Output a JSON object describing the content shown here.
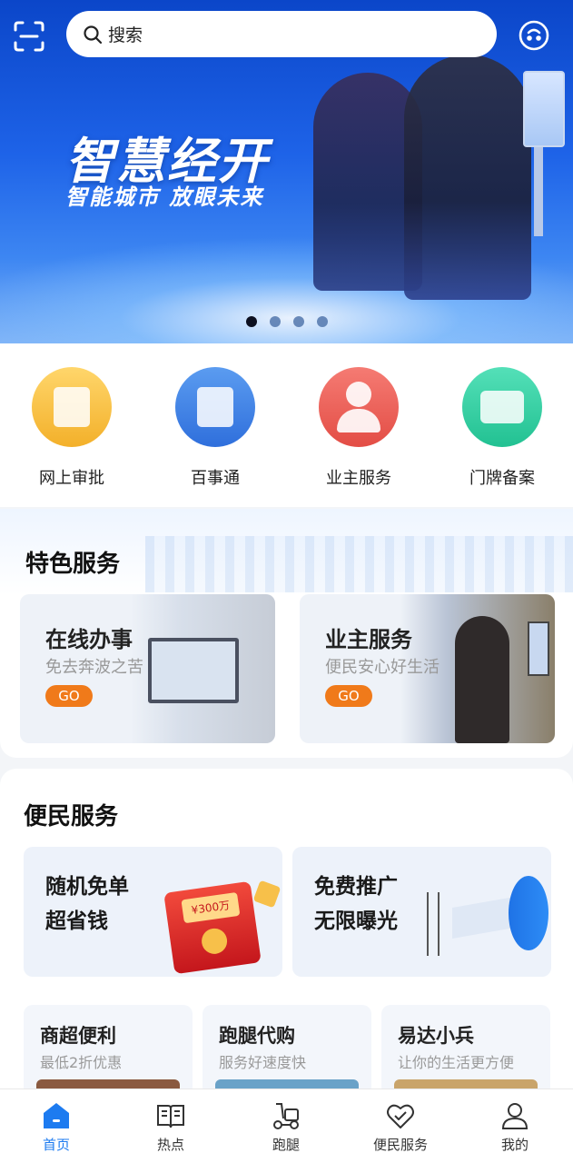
{
  "search": {
    "placeholder": "搜索"
  },
  "banner": {
    "title": "智慧经开",
    "subtitle": "智能城市 放眼未来",
    "slides": 4,
    "active_slide": 1
  },
  "quick_actions": [
    {
      "label": "网上审批",
      "icon": "approval-document-icon",
      "color": "#f3b02a"
    },
    {
      "label": "百事通",
      "icon": "info-card-icon",
      "color": "#2f6fdc"
    },
    {
      "label": "业主服务",
      "icon": "owner-person-icon",
      "color": "#e34d45"
    },
    {
      "label": "门牌备案",
      "icon": "house-plate-icon",
      "color": "#22c192"
    }
  ],
  "special": {
    "title": "特色服务",
    "cards": [
      {
        "title": "在线办事",
        "subtitle": "免去奔波之苦",
        "cta": "GO"
      },
      {
        "title": "业主服务",
        "subtitle": "便民安心好生活",
        "cta": "GO"
      }
    ]
  },
  "convenience": {
    "title": "便民服务",
    "big_cards": [
      {
        "line1": "随机免单",
        "line2": "超省钱"
      },
      {
        "line1": "免费推广",
        "line2": "无限曝光"
      }
    ],
    "small_cards": [
      {
        "title": "商超便利",
        "subtitle": "最低2折优惠"
      },
      {
        "title": "跑腿代购",
        "subtitle": "服务好速度快"
      },
      {
        "title": "易达小兵",
        "subtitle": "让你的生活更方便"
      }
    ],
    "red_packet_text": "¥300万"
  },
  "tabs": [
    {
      "label": "首页",
      "icon": "home-icon",
      "active": true
    },
    {
      "label": "热点",
      "icon": "book-icon",
      "active": false
    },
    {
      "label": "跑腿",
      "icon": "scooter-icon",
      "active": false
    },
    {
      "label": "便民服务",
      "icon": "heart-check-icon",
      "active": false
    },
    {
      "label": "我的",
      "icon": "person-icon",
      "active": false
    }
  ],
  "colors": {
    "accent": "#1d7bf0",
    "go_button": "#f07a1a"
  }
}
